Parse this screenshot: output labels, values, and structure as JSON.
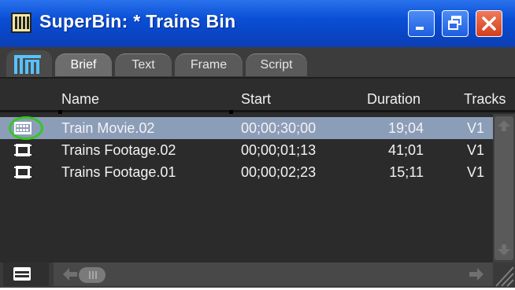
{
  "window": {
    "title": "SuperBin: * Trains Bin"
  },
  "tabs": [
    {
      "label": "Brief"
    },
    {
      "label": "Text"
    },
    {
      "label": "Frame"
    },
    {
      "label": "Script"
    }
  ],
  "columns": {
    "name": "Name",
    "start": "Start",
    "duration": "Duration",
    "tracks": "Tracks"
  },
  "rows": [
    {
      "icon": "sequence-icon",
      "name": "Train Movie.02",
      "start": "00;00;30;00",
      "duration": "19;04",
      "tracks": "V1",
      "selected": true
    },
    {
      "icon": "clip-icon",
      "name": "Trains Footage.02",
      "start": "00;00;01;13",
      "duration": "41;01",
      "tracks": "V1",
      "selected": false
    },
    {
      "icon": "clip-icon",
      "name": "Trains Footage.01",
      "start": "00;00;02;23",
      "duration": "15;11",
      "tracks": "V1",
      "selected": false
    }
  ],
  "colors": {
    "titlebar": "#0a4fd6",
    "selection": "#8c9db8",
    "highlight": "#34c626"
  }
}
